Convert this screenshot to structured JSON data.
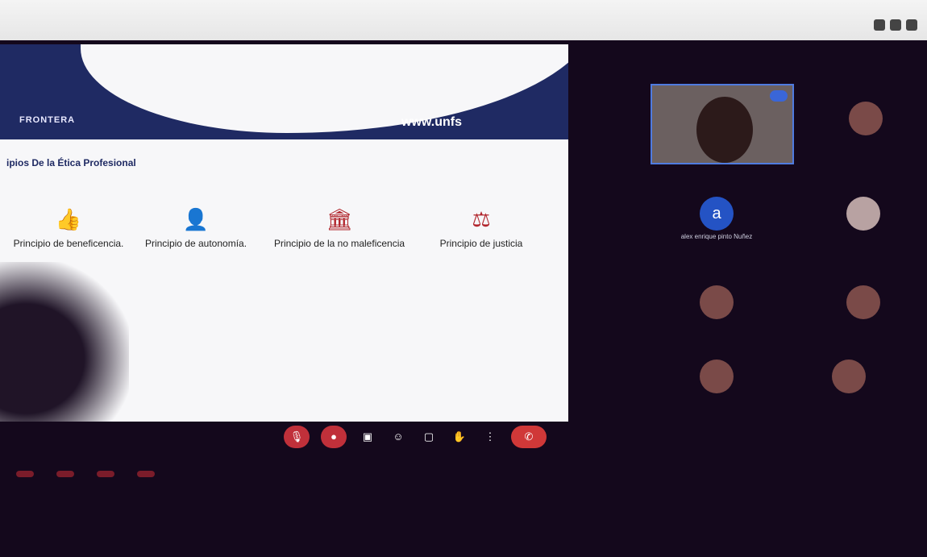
{
  "slide": {
    "brand": "FRONTERA",
    "url": "www.unfs",
    "title": "ipios De la Ética Profesional",
    "principles": [
      {
        "icon": "thumbs-up-icon",
        "glyph": "👍",
        "title": "Principio de beneficencia.",
        "text": ""
      },
      {
        "icon": "user-check-icon",
        "glyph": "👤",
        "title": "Principio de autonomía.",
        "text": ""
      },
      {
        "icon": "building-icon",
        "glyph": "🏛",
        "title": "Principio de la no maleficencia",
        "text": ""
      },
      {
        "icon": "scales-icon",
        "glyph": "⚖",
        "title": "Principio de justicia",
        "text": ""
      }
    ]
  },
  "participants": [
    {
      "name": "",
      "avatar": "photo",
      "letter": ""
    },
    {
      "name": "",
      "avatar": "photo",
      "letter": ""
    },
    {
      "name": "alex enrique pinto Nuñez",
      "avatar": "letter",
      "letter": "a"
    },
    {
      "name": "",
      "avatar": "photo-light",
      "letter": ""
    },
    {
      "name": "",
      "avatar": "photo",
      "letter": ""
    },
    {
      "name": "",
      "avatar": "photo",
      "letter": ""
    },
    {
      "name": "",
      "avatar": "photo",
      "letter": ""
    },
    {
      "name": "",
      "avatar": "photo",
      "letter": ""
    }
  ],
  "toolbar": [
    {
      "icon": "mic-off-icon",
      "glyph": "🎙",
      "style": "red"
    },
    {
      "icon": "camera-off-icon",
      "glyph": "●",
      "style": "red"
    },
    {
      "icon": "captions-icon",
      "glyph": "▣",
      "style": "flat"
    },
    {
      "icon": "emoji-icon",
      "glyph": "☺",
      "style": "flat"
    },
    {
      "icon": "present-icon",
      "glyph": "▢",
      "style": "flat"
    },
    {
      "icon": "raise-hand-icon",
      "glyph": "✋",
      "style": "flat"
    },
    {
      "icon": "more-options-icon",
      "glyph": "⋮",
      "style": "flat"
    },
    {
      "icon": "end-call-icon",
      "glyph": "✆",
      "style": "end"
    }
  ],
  "colors": {
    "brand": "#1f2a63",
    "accent": "#b1252c",
    "active_border": "#4f7be0"
  }
}
